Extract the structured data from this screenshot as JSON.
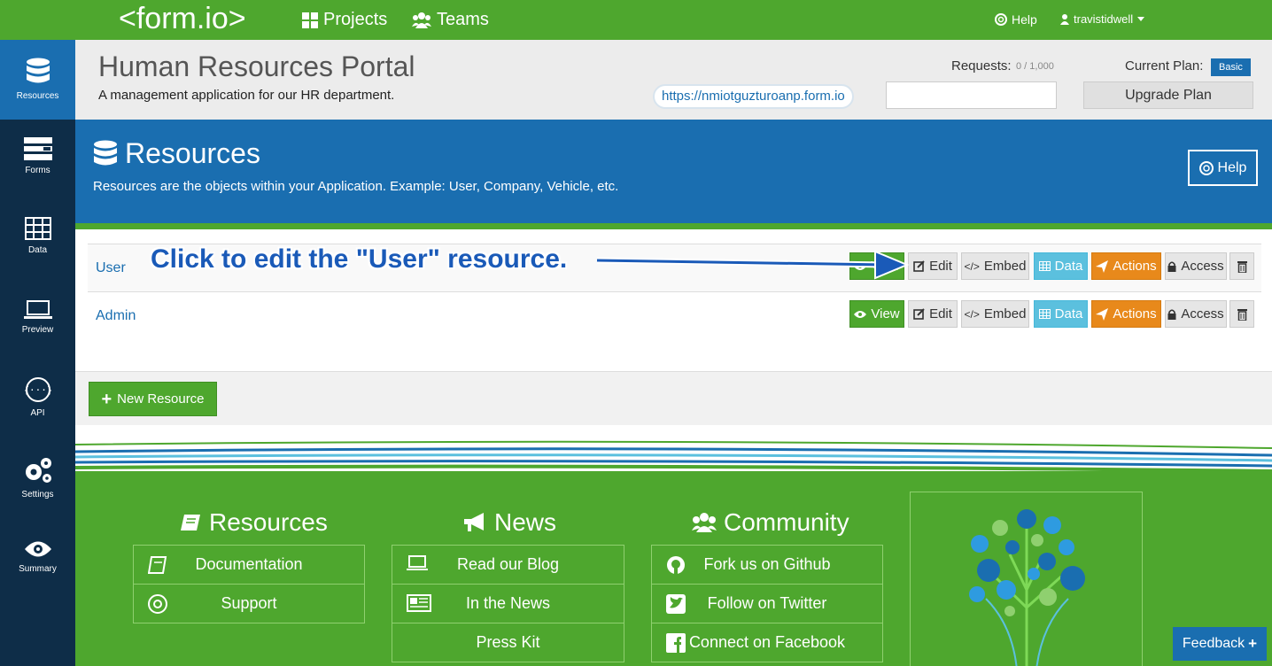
{
  "colors": {
    "brand_green": "#4ea72e",
    "brand_blue": "#1a6eb0",
    "sidebar_navy": "#0e2d48",
    "action_orange": "#e8891b",
    "data_cyan": "#5bc0de"
  },
  "topnav": {
    "logo": "<form.io>",
    "projects_label": "Projects",
    "teams_label": "Teams",
    "help_label": "Help",
    "user_label": "travistidwell"
  },
  "sidebar": {
    "items": [
      {
        "label": "Resources",
        "icon": "database-icon",
        "active": true
      },
      {
        "label": "Forms",
        "icon": "forms-icon"
      },
      {
        "label": "Data",
        "icon": "table-icon"
      },
      {
        "label": "Preview",
        "icon": "laptop-icon"
      },
      {
        "label": "API",
        "icon": "code-icon"
      },
      {
        "label": "Settings",
        "icon": "gears-icon"
      },
      {
        "label": "Summary",
        "icon": "eye-icon"
      }
    ]
  },
  "project": {
    "title": "Human Resources Portal",
    "description": "A management application for our HR department.",
    "url": "https://nmiotguzturoanp.form.io",
    "requests_label": "Requests:",
    "requests_count": "0 / 1,000",
    "plan_label": "Current Plan:",
    "plan_value": "Basic",
    "upgrade_label": "Upgrade Plan"
  },
  "banner": {
    "title": "Resources",
    "description": "Resources are the objects within your Application. Example: User, Company, Vehicle, etc.",
    "help_label": "Help"
  },
  "resources": [
    {
      "name": "User"
    },
    {
      "name": "Admin"
    }
  ],
  "row_buttons": {
    "view": "View",
    "edit": "Edit",
    "embed": "Embed",
    "data": "Data",
    "actions": "Actions",
    "access": "Access"
  },
  "new_resource_label": "New Resource",
  "annotation": "Click to edit the \"User\" resource.",
  "footer": {
    "resources": {
      "title": "Resources",
      "links": [
        "Documentation",
        "Support"
      ]
    },
    "news": {
      "title": "News",
      "links": [
        "Read our Blog",
        "In the News",
        "Press Kit"
      ]
    },
    "community": {
      "title": "Community",
      "links": [
        "Fork us on Github",
        "Follow on Twitter",
        "Connect on Facebook"
      ]
    }
  },
  "feedback_label": "Feedback"
}
